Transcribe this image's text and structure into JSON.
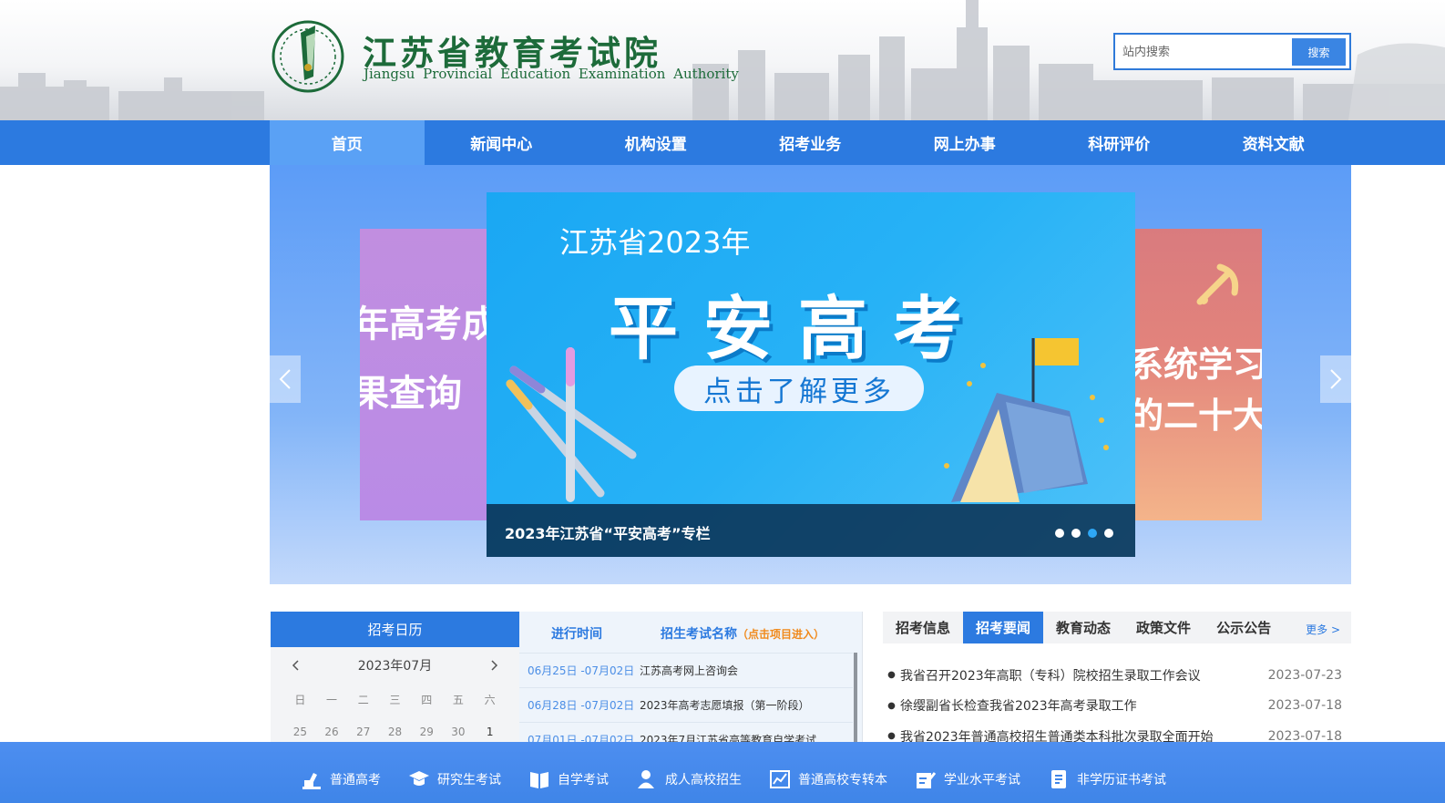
{
  "header": {
    "title": "江苏省教育考试院",
    "subtitle": "Jiangsu Provincial Education Examination Authority",
    "search": {
      "placeholder": "站内搜索",
      "button": "搜索"
    }
  },
  "nav": [
    "首页",
    "新闻中心",
    "机构设置",
    "招考业务",
    "网上办事",
    "科研评价",
    "资料文献"
  ],
  "banner": {
    "left_text_1": "年高考成",
    "left_text_2": "果查询",
    "right_text_1": "系统学习",
    "right_text_2": "的二十大",
    "kicker": "江苏省2023年",
    "title": "平安高考",
    "cta": "点击了解更多",
    "caption": "2023年江苏省“平安高考”专栏",
    "active_dot": 3,
    "dot_count": 4
  },
  "calendar": {
    "title": "招考日历",
    "month": "2023年07月",
    "weekdays": [
      "日",
      "一",
      "二",
      "三",
      "四",
      "五",
      "六"
    ],
    "days": [
      "25",
      "26",
      "27",
      "28",
      "29",
      "30",
      "1"
    ]
  },
  "exams": {
    "col_time": "进行时间",
    "col_name": "招生考试名称",
    "col_name_hint": "（点击项目进入）",
    "rows": [
      {
        "date": "06月25日 -07月02日",
        "name": "江苏高考网上咨询会"
      },
      {
        "date": "06月28日 -07月02日",
        "name": "2023年高考志愿填报（第一阶段）"
      },
      {
        "date": "07月01日 -07月02日",
        "name": "2023年7月江苏省高等教育自学考试"
      }
    ]
  },
  "news": {
    "tabs": [
      "招考信息",
      "招考要闻",
      "教育动态",
      "政策文件",
      "公示公告"
    ],
    "active_tab": 1,
    "more": "更多 >",
    "items": [
      {
        "title": "我省召开2023年高职（专科）院校招生录取工作会议",
        "date": "2023-07-23"
      },
      {
        "title": "徐缨副省长检查我省2023年高考录取工作",
        "date": "2023-07-18"
      },
      {
        "title": "我省2023年普通高校招生普通类本科批次录取全面开始",
        "date": "2023-07-18"
      }
    ]
  },
  "bottom_links": [
    {
      "label": "普通高考",
      "icon": "exam-icon"
    },
    {
      "label": "研究生考试",
      "icon": "graduate-cap-icon"
    },
    {
      "label": "自学考试",
      "icon": "book-icon"
    },
    {
      "label": "成人高校招生",
      "icon": "person-icon"
    },
    {
      "label": "普通高校专转本",
      "icon": "chart-icon"
    },
    {
      "label": "学业水平考试",
      "icon": "pencil-doc-icon"
    },
    {
      "label": "非学历证书考试",
      "icon": "certificate-icon"
    }
  ],
  "colors": {
    "primary": "#2c7ae0",
    "brand_green": "#1d6b3a",
    "accent_orange": "#f08a1c"
  }
}
